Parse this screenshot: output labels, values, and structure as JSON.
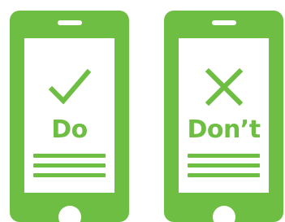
{
  "panels": {
    "do": {
      "label": "Do",
      "symbol_icon": "checkmark-icon"
    },
    "dont": {
      "label": "Don’t",
      "symbol_icon": "x-mark-icon"
    }
  },
  "colors": {
    "accent": "#6fbe44",
    "background": "#ffffff"
  }
}
